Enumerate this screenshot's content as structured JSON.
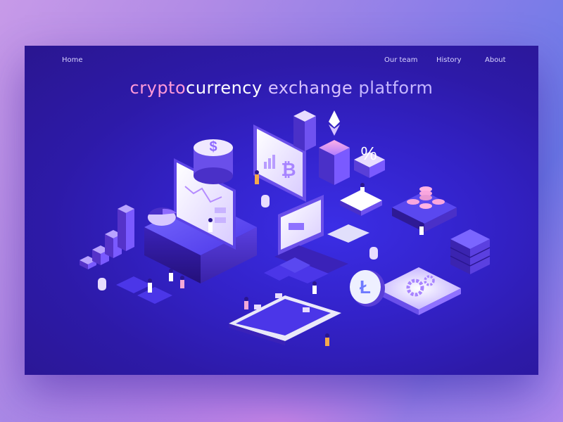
{
  "nav": {
    "home": "Home",
    "our_team": "Our team",
    "history": "History",
    "about": "About"
  },
  "hero": {
    "title_part1": "crypto",
    "title_part2": "currency",
    "title_part3": "exchange",
    "title_part4": "platform"
  },
  "colors": {
    "frame_dark": "#2a1690",
    "frame_mid": "#3b2ee6",
    "accent_pink": "#ff9ad8",
    "accent_lavender": "#d8c2ff",
    "platform_top": "#5a48f0",
    "glow_white": "#f4f0ff"
  },
  "icons": [
    "dollar-icon",
    "bitcoin-icon",
    "ethereum-icon",
    "percent-icon",
    "litecoin-icon",
    "gear-icon",
    "server-icon",
    "coins-icon",
    "bar-chart-icon",
    "pie-chart-icon"
  ]
}
